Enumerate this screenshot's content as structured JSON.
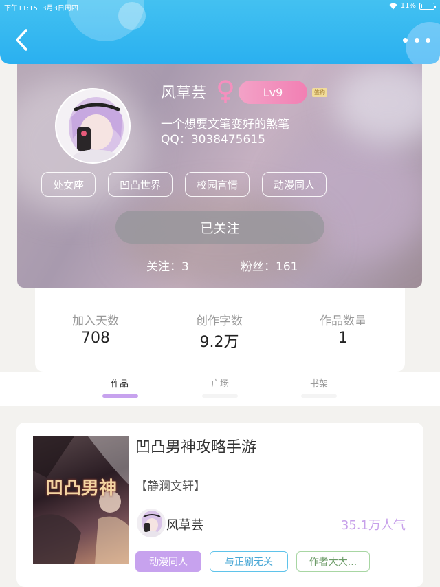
{
  "status_bar": {
    "time": "下午11:15",
    "date": "3月3日周四",
    "battery": "11%",
    "battery_level": 0.11
  },
  "header": {
    "back_icon": "chevron-left-icon",
    "more_icon": "more-dots-icon"
  },
  "profile": {
    "name": "风草芸",
    "gender_icon": "female-icon",
    "level": "Lv9",
    "sign_badge": "签约",
    "bio": "一个想要文笔变好的煞笔",
    "qq": "QQ：3038475615",
    "tags": [
      "处女座",
      "凹凸世界",
      "校园言情",
      "动漫同人"
    ],
    "follow_button": "已关注",
    "following": "关注：3",
    "fans": "粉丝：161"
  },
  "stats": [
    {
      "label": "加入天数",
      "value": "708"
    },
    {
      "label": "创作字数",
      "value": "9.2万"
    },
    {
      "label": "作品数量",
      "value": "1"
    }
  ],
  "tabs": [
    {
      "label": "作品",
      "active": true
    },
    {
      "label": "广场",
      "active": false
    },
    {
      "label": "书架",
      "active": false
    }
  ],
  "work": {
    "title": "凹凸男神攻略手游",
    "author_tag": "【静澜文轩】",
    "author_name": "风草芸",
    "popularity": "35.1万人气",
    "cover_text": "凹凸男神",
    "tags": [
      "动漫同人",
      "与正剧无关",
      "作者大大..."
    ]
  },
  "colors": {
    "header": "#2ab0f0",
    "level_badge": "#f27fb3",
    "tab_active": "#c7a2ee",
    "popularity": "#c7a0ea"
  }
}
